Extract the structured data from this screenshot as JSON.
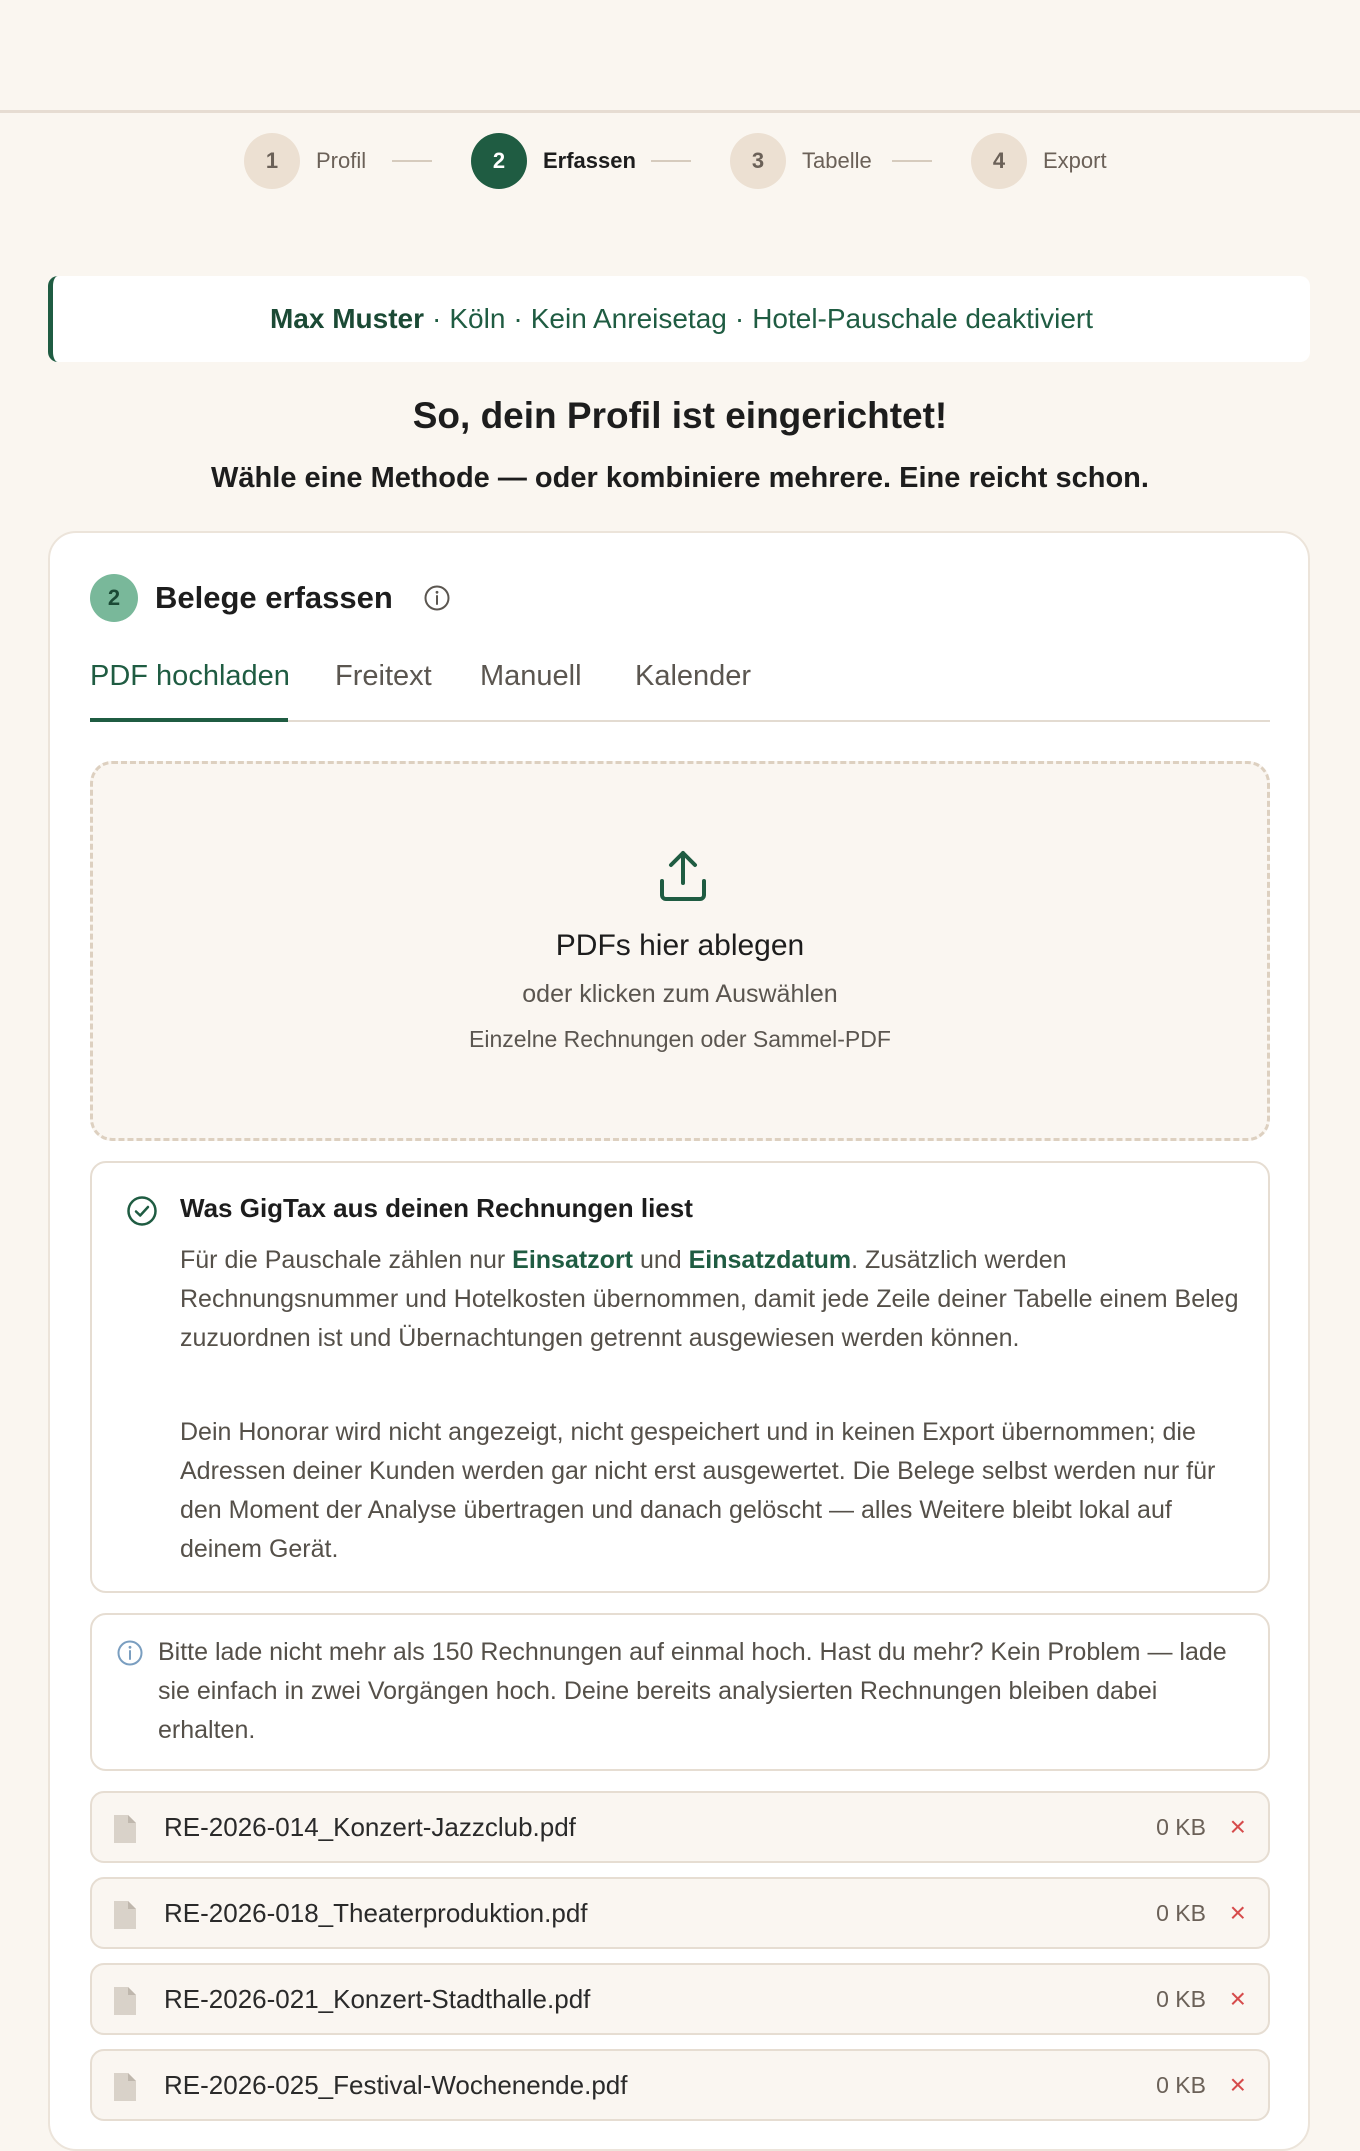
{
  "stepper": {
    "steps": [
      {
        "number": "1",
        "label": "Profil",
        "state": "inactive"
      },
      {
        "number": "2",
        "label": "Erfassen",
        "state": "active"
      },
      {
        "number": "3",
        "label": "Tabelle",
        "state": "inactive"
      },
      {
        "number": "4",
        "label": "Export",
        "state": "inactive"
      }
    ]
  },
  "profile_banner": {
    "name": "Max Muster",
    "separator": "·",
    "city": "Köln",
    "arrival": "Kein Anreisetag",
    "hotel": "Hotel-Pauschale deaktiviert"
  },
  "headline": {
    "title": "So, dein Profil ist eingerichtet!",
    "subtitle": "Wähle eine Methode — oder kombiniere mehrere. Eine reicht schon."
  },
  "card": {
    "step_number": "2",
    "title": "Belege erfassen",
    "tabs": [
      {
        "label": "PDF hochladen",
        "active": true
      },
      {
        "label": "Freitext",
        "active": false
      },
      {
        "label": "Manuell",
        "active": false
      },
      {
        "label": "Kalender",
        "active": false
      }
    ],
    "dropzone": {
      "title": "PDFs hier ablegen",
      "subtitle": "oder klicken zum Auswählen",
      "hint": "Einzelne Rechnungen oder Sammel-PDF"
    },
    "explain": {
      "title": "Was GigTax aus deinen Rechnungen liest",
      "p1_a": "Für die Pauschale zählen nur ",
      "p1_b": "Einsatzort",
      "p1_c": " und ",
      "p1_d": "Einsatzdatum",
      "p1_e": ". Zusätzlich werden Rechnungsnummer und Hotelkosten übernommen, damit jede Zeile deiner Tabelle einem Beleg zuzuordnen ist und Übernachtungen getrennt ausgewiesen werden können.",
      "p2": "Dein Honorar wird nicht angezeigt, nicht gespeichert und in keinen Export übernommen; die Adressen deiner Kunden werden gar nicht erst ausgewertet. Die Belege selbst werden nur für den Moment der Analyse übertragen und danach gelöscht — alles Weitere bleibt lokal auf deinem Gerät."
    },
    "notice": {
      "text": "Bitte lade nicht mehr als 150 Rechnungen auf einmal hoch. Hast du mehr? Kein Problem — lade sie einfach in zwei Vorgängen hoch. Deine bereits analysierten Rechnungen bleiben dabei erhalten."
    },
    "files": [
      {
        "name": "RE-2026-014_Konzert-Jazzclub.pdf",
        "size": "0 KB",
        "remove": "×"
      },
      {
        "name": "RE-2026-018_Theaterproduktion.pdf",
        "size": "0 KB",
        "remove": "×"
      },
      {
        "name": "RE-2026-021_Konzert-Stadthalle.pdf",
        "size": "0 KB",
        "remove": "×"
      },
      {
        "name": "RE-2026-025_Festival-Wochenende.pdf",
        "size": "0 KB",
        "remove": "×"
      }
    ]
  },
  "colors": {
    "accent": "#1f5c42",
    "background": "#faf6f0",
    "danger": "#d64b4b"
  }
}
